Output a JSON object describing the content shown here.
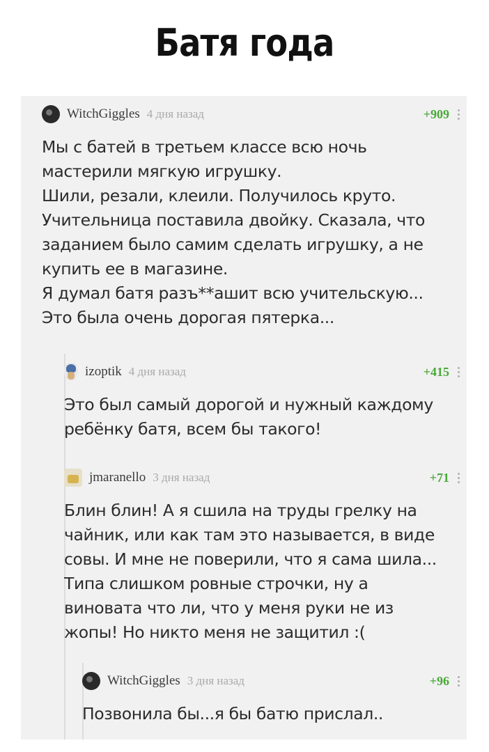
{
  "meme_title": "Батя года",
  "comments": [
    {
      "author": "WitchGiggles",
      "time": "4 дня назад",
      "rating": "+909",
      "avatar_icon": "user-avatar-dark",
      "lines": [
        "Мы с батей в третьем классе всю ночь",
        "мастерили мягкую игрушку.",
        "Шили, резали, клеили. Получилось круто.",
        "Учительница поставила двойку. Сказала, что",
        "заданием было самим сделать игрушку, а не",
        "купить ее в магазине.",
        "Я думал батя разъ**ашит всю учительскую...",
        "Это была очень дорогая пятерка..."
      ]
    },
    {
      "author": "izoptik",
      "time": "4 дня назад",
      "rating": "+415",
      "avatar_icon": "user-avatar-figure",
      "lines": [
        "Это был самый дорогой и нужный каждому",
        "ребёнку батя, всем бы такого!"
      ]
    },
    {
      "author": "jmaranello",
      "time": "3 дня назад",
      "rating": "+71",
      "avatar_icon": "user-avatar-picture",
      "lines": [
        "Блин блин! А я сшила на труды грелку на",
        "чайник, или как там это называется, в виде",
        "совы. И мне не поверили, что я сама шила...",
        "Типа слишком ровные строчки, ну а",
        "виновата что ли, что у меня руки не из",
        "жопы! Но никто меня не защитил :("
      ]
    },
    {
      "author": "WitchGiggles",
      "time": "3 дня назад",
      "rating": "+96",
      "avatar_icon": "user-avatar-dark",
      "lines": [
        "Позвонила бы...я бы батю прислал.."
      ]
    }
  ],
  "colors": {
    "rating": "#4aa838",
    "time": "#a9a9a9",
    "panel_bg": "#f1f1f1"
  }
}
